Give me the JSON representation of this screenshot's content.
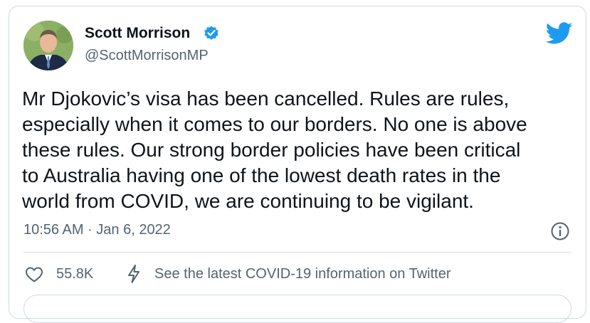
{
  "author": {
    "name": "Scott Morrison",
    "handle": "@ScottMorrisonMP",
    "verified": true,
    "avatar_icon": "person-avatar"
  },
  "brand": {
    "icon": "twitter-bird-icon",
    "color": "#1d9bf0"
  },
  "tweet": {
    "lines": [
      "Mr Djokovic’s visa has been cancelled. Rules are rules,",
      "especially when it comes to our borders. No one is above",
      "these rules. Our strong border policies have been critical",
      "to Australia having one of the lowest death rates in the",
      "world from COVID, we are continuing to be vigilant."
    ],
    "timestamp": "10:56 AM · Jan 6, 2022"
  },
  "actions": {
    "like_count": "55.8K",
    "covid_link": "See the latest COVID-19 information on Twitter"
  },
  "colors": {
    "text": "#0f1419",
    "secondary": "#536471",
    "border": "#cfd9de",
    "verified": "#1d9bf0"
  }
}
